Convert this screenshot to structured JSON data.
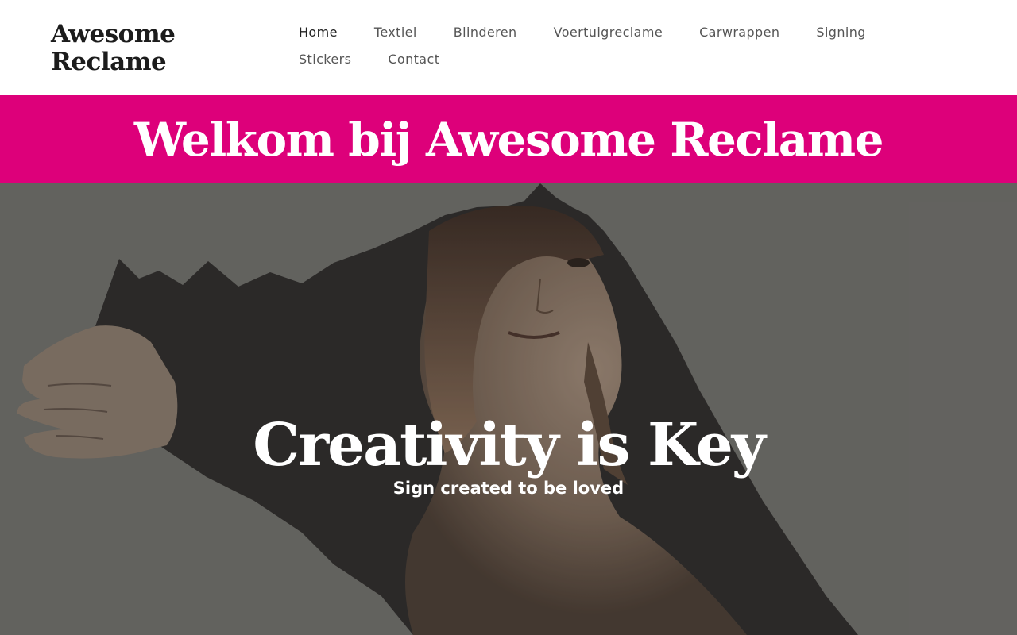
{
  "header": {
    "logo_line1": "Awesome",
    "logo_line2": "Reclame",
    "nav": [
      {
        "label": "Home"
      },
      {
        "label": "Textiel"
      },
      {
        "label": "Blinderen"
      },
      {
        "label": "Voertuigreclame"
      },
      {
        "label": "Carwrappen"
      },
      {
        "label": "Signing"
      },
      {
        "label": "Stickers"
      },
      {
        "label": "Contact"
      }
    ],
    "separator": "—"
  },
  "banner": {
    "title": "Welkom bij Awesome Reclame"
  },
  "hero": {
    "title": "Creativity is Key",
    "subtitle": "Sign created to be loved",
    "image": "woman-torn-paper-photo"
  },
  "colors": {
    "accent": "#dd007a",
    "hero_bg": "#6b6a66",
    "text_dark": "#1c1c1c",
    "nav_text": "#555555"
  }
}
